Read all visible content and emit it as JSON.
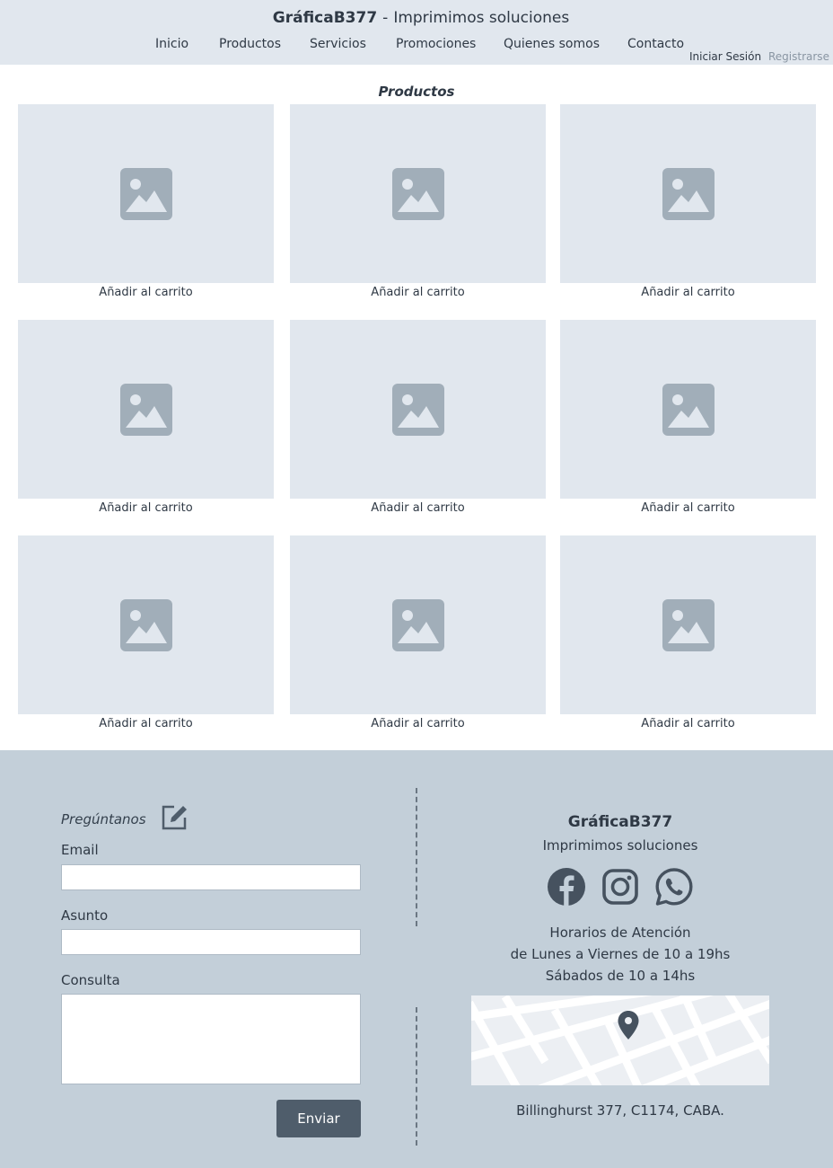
{
  "header": {
    "brand_name": "GráficaB377",
    "brand_separator": "-",
    "brand_tagline": "Imprimimos soluciones",
    "nav": [
      "Inicio",
      "Productos",
      "Servicios",
      "Promociones",
      "Quienes somos",
      "Contacto"
    ],
    "login_label": "Iniciar Sesión",
    "register_label": "Registrarse"
  },
  "products": {
    "title": "Productos",
    "items": [
      {
        "image_icon": "image-placeholder-icon",
        "cta": "Añadir al carrito"
      },
      {
        "image_icon": "image-placeholder-icon",
        "cta": "Añadir al carrito"
      },
      {
        "image_icon": "image-placeholder-icon",
        "cta": "Añadir al carrito"
      },
      {
        "image_icon": "image-placeholder-icon",
        "cta": "Añadir al carrito"
      },
      {
        "image_icon": "image-placeholder-icon",
        "cta": "Añadir al carrito"
      },
      {
        "image_icon": "image-placeholder-icon",
        "cta": "Añadir al carrito"
      },
      {
        "image_icon": "image-placeholder-icon",
        "cta": "Añadir al carrito"
      },
      {
        "image_icon": "image-placeholder-icon",
        "cta": "Añadir al carrito"
      },
      {
        "image_icon": "image-placeholder-icon",
        "cta": "Añadir al carrito"
      }
    ]
  },
  "contact_form": {
    "title": "Pregúntanos",
    "title_icon": "edit-icon",
    "email_label": "Email",
    "email_value": "",
    "subject_label": "Asunto",
    "subject_value": "",
    "message_label": "Consulta",
    "message_value": "",
    "submit_label": "Enviar"
  },
  "info": {
    "name": "GráficaB377",
    "tagline": "Imprimimos soluciones",
    "social_icons": [
      "facebook-icon",
      "instagram-icon",
      "whatsapp-icon"
    ],
    "hours_title": "Horarios de Atención",
    "hours_weekdays": "de Lunes a Viernes de 10 a 19hs",
    "hours_saturday": "Sábados de 10 a 14hs",
    "map_icon": "map-pin-icon",
    "address": "Billinghurst 377, C1174, CABA."
  },
  "colors": {
    "header_bg": "#e1e7ee",
    "footer_bg": "#c3cfd9",
    "button_bg": "#4f5d6b",
    "placeholder_icon": "#a1aeb9",
    "text": "#2f3945"
  }
}
